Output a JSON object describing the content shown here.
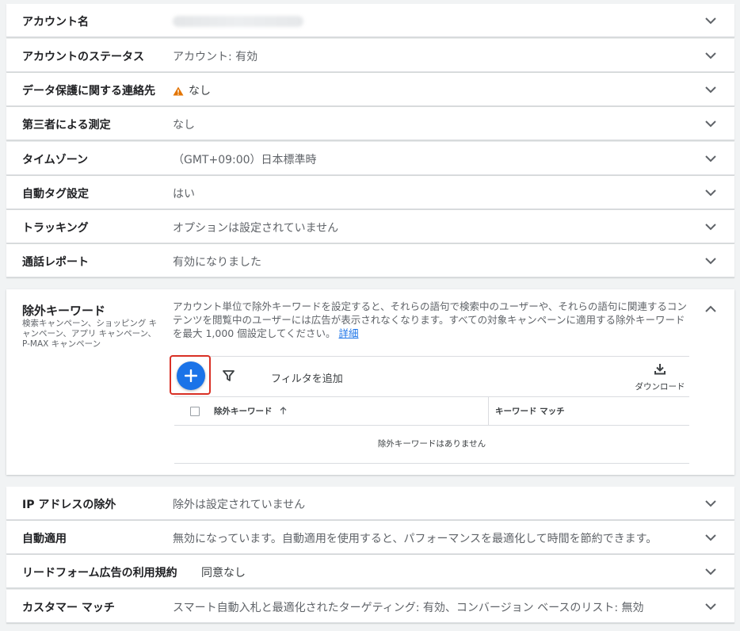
{
  "settings_top": [
    {
      "label": "アカウント名",
      "value": ""
    },
    {
      "label": "アカウントのステータス",
      "value": "アカウント: 有効"
    },
    {
      "label": "データ保護に関する連絡先",
      "value": "なし"
    },
    {
      "label": "第三者による測定",
      "value": "なし"
    },
    {
      "label": "タイムゾーン",
      "value": "（GMT+09:00）日本標準時"
    },
    {
      "label": "自動タグ設定",
      "value": "はい"
    },
    {
      "label": "トラッキング",
      "value": "オプションは設定されていません"
    },
    {
      "label": "通話レポート",
      "value": "有効になりました"
    }
  ],
  "negative_keywords": {
    "title": "除外キーワード",
    "subtitle": "検索キャンペーン、ショッピング キャンペーン、アプリ キャンペーン、P-MAX キャンペーン",
    "description": "アカウント単位で除外キーワードを設定すると、それらの語句で検索中のユーザーや、それらの語句に関連するコンテンツを閲覧中のユーザーには広告が表示されなくなります。すべての対象キャンペーンに適用する除外キーワードを最大 1,000 個設定してください。",
    "details_link": "詳細",
    "add_filter": "フィルタを追加",
    "download": "ダウンロード",
    "col_keyword": "除外キーワード",
    "col_match": "キーワード マッチ",
    "empty_message": "除外キーワードはありません"
  },
  "settings_bottom": [
    {
      "label": "IP アドレスの除外",
      "value": "除外は設定されていません"
    },
    {
      "label": "自動適用",
      "value": "無効になっています。自動適用を使用すると、パフォーマンスを最適化して時間を節約できます。"
    },
    {
      "label": "リードフォーム広告の利用規約",
      "value": "同意なし"
    },
    {
      "label": "カスタマー マッチ",
      "value": "スマート自動入札と最適化されたターゲティング: 有効、コンバージョン ベースのリスト: 無効"
    }
  ],
  "colors": {
    "accent": "#1a73e8",
    "warning": "#e37400",
    "highlight": "#d93025"
  }
}
